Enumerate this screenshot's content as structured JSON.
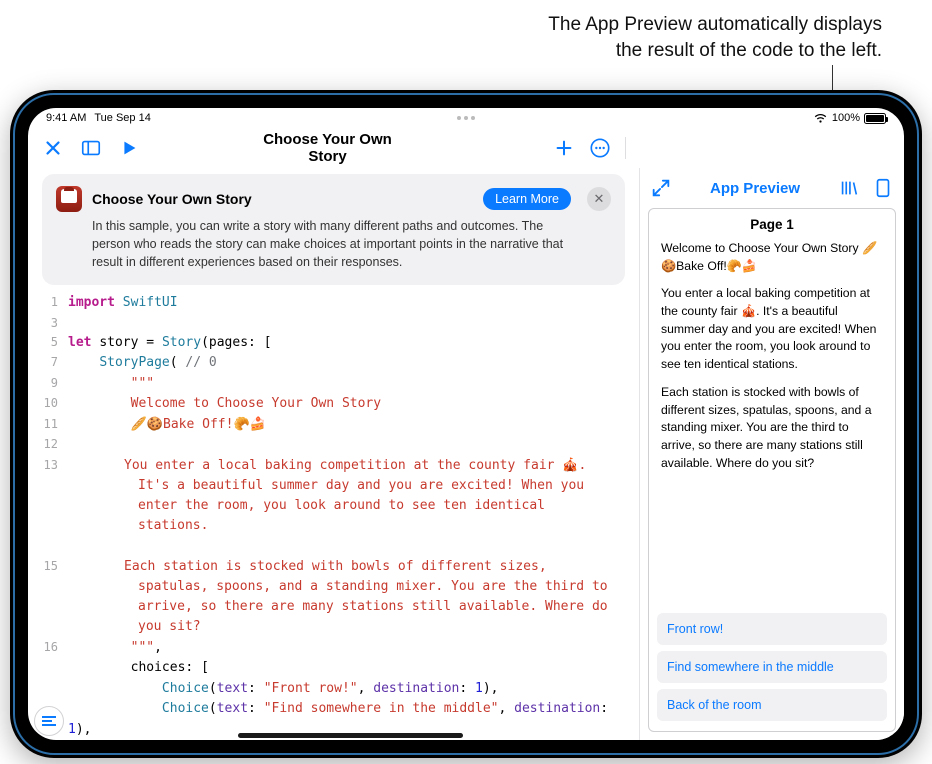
{
  "callout": {
    "line1": "The App Preview automatically displays",
    "line2": "the result of the code to the left."
  },
  "status": {
    "time": "9:41 AM",
    "date": "Tue Sep 14",
    "battery_pct": "100%"
  },
  "toolbar": {
    "title": "Choose Your Own Story"
  },
  "info": {
    "title": "Choose Your Own Story",
    "learn_more": "Learn More",
    "body": "In this sample, you can write a story with many different paths and outcomes. The person who reads the story can make choices at important points in the narrative that result in different experiences based on their responses."
  },
  "code": {
    "lines": [
      {
        "n": "1",
        "indent": 0,
        "seg": [
          {
            "t": "import ",
            "c": "kw"
          },
          {
            "t": "SwiftUI",
            "c": "type"
          }
        ]
      },
      {
        "n": "3",
        "indent": 0,
        "seg": []
      },
      {
        "n": "5",
        "indent": 0,
        "seg": [
          {
            "t": "let ",
            "c": "kw"
          },
          {
            "t": "story = ",
            "c": ""
          },
          {
            "t": "Story",
            "c": "type"
          },
          {
            "t": "(pages: [",
            "c": ""
          }
        ]
      },
      {
        "n": "7",
        "indent": 1,
        "seg": [
          {
            "t": "StoryPage",
            "c": "type"
          },
          {
            "t": "( ",
            "c": ""
          },
          {
            "t": "// 0",
            "c": "cmt"
          }
        ]
      },
      {
        "n": "9",
        "indent": 2,
        "seg": [
          {
            "t": "\"\"\"",
            "c": "str"
          }
        ]
      },
      {
        "n": "10",
        "indent": 2,
        "seg": [
          {
            "t": "Welcome to Choose Your Own Story",
            "c": "str"
          }
        ]
      },
      {
        "n": "11",
        "indent": 2,
        "seg": [
          {
            "t": "🥖🍪Bake Off!🥐🍰",
            "c": "str"
          }
        ]
      },
      {
        "n": "12",
        "indent": 2,
        "seg": []
      },
      {
        "n": "13",
        "indent": 2,
        "wrap": true,
        "seg": [
          {
            "t": "You enter a local baking competition at the county fair 🎪. It's a beautiful summer day and you are excited! When you enter the room, you look around to see ten identical stations.",
            "c": "str"
          }
        ]
      },
      {
        "n": "",
        "indent": 2,
        "seg": []
      },
      {
        "n": "15",
        "indent": 2,
        "wrap": true,
        "seg": [
          {
            "t": "Each station is stocked with bowls of different sizes, spatulas, spoons, and a standing mixer. You are the third to arrive, so there are many stations still available. Where do you sit?",
            "c": "str"
          }
        ]
      },
      {
        "n": "16",
        "indent": 2,
        "seg": [
          {
            "t": "\"\"\"",
            "c": "str"
          },
          {
            "t": ",",
            "c": ""
          }
        ]
      },
      {
        "n": "",
        "indent": 2,
        "seg": [
          {
            "t": "choices: [",
            "c": ""
          }
        ]
      },
      {
        "n": "",
        "indent": 3,
        "seg": [
          {
            "t": "Choice",
            "c": "type"
          },
          {
            "t": "(",
            "c": ""
          },
          {
            "t": "text",
            "c": "prop"
          },
          {
            "t": ": ",
            "c": ""
          },
          {
            "t": "\"Front row!\"",
            "c": "str"
          },
          {
            "t": ", ",
            "c": ""
          },
          {
            "t": "destination",
            "c": "prop"
          },
          {
            "t": ": ",
            "c": ""
          },
          {
            "t": "1",
            "c": "num"
          },
          {
            "t": "),",
            "c": ""
          }
        ]
      },
      {
        "n": "",
        "indent": 3,
        "seg": [
          {
            "t": "Choice",
            "c": "type"
          },
          {
            "t": "(",
            "c": ""
          },
          {
            "t": "text",
            "c": "prop"
          },
          {
            "t": ": ",
            "c": ""
          },
          {
            "t": "\"Find somewhere in the middle\"",
            "c": "str"
          },
          {
            "t": ", ",
            "c": ""
          },
          {
            "t": "destination",
            "c": "prop"
          },
          {
            "t": ": ",
            "c": ""
          },
          {
            "t": "1",
            "c": "num"
          },
          {
            "t": "),",
            "c": ""
          }
        ]
      }
    ]
  },
  "preview": {
    "title": "App Preview",
    "page_title": "Page 1",
    "p1": "Welcome to Choose Your Own Story 🥖🍪Bake Off!🥐🍰",
    "p2": "You enter a local baking competition at the county fair 🎪. It's a beautiful summer day and you are excited! When you enter the room, you look around to see ten identical stations.",
    "p3": "Each station is stocked with bowls of different sizes, spatulas, spoons, and a standing mixer. You are the third to arrive, so there are many stations still available. Where do you sit?",
    "choices": [
      "Front row!",
      "Find somewhere in the middle",
      "Back of the room"
    ]
  }
}
